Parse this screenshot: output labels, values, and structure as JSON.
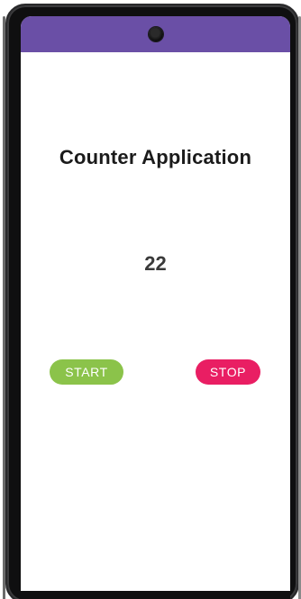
{
  "device": {
    "status_bar_color": "#6a4fa6"
  },
  "app": {
    "title": "Counter Application",
    "counter_value": "22",
    "buttons": {
      "start_label": "START",
      "stop_label": "STOP",
      "start_color": "#8bc34a",
      "stop_color": "#e91e63"
    }
  }
}
